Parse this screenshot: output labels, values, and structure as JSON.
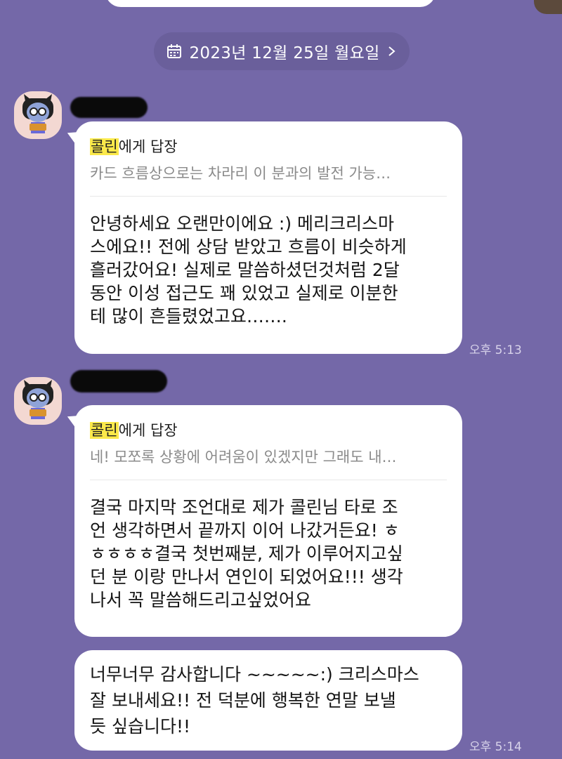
{
  "date_divider": {
    "label": "2023년 12월 25일 월요일",
    "icon": "calendar-icon",
    "chevron": "chevron-right-icon"
  },
  "messages": [
    {
      "reply": {
        "target": "콜린",
        "suffix": "에게 답장",
        "preview": "카드 흐름상으로는 차라리 이 분과의 발전 가능…"
      },
      "lines": [
        "안녕하세요 오랜만이에요 :) 메리크리스마",
        "스에요!! 전에 상담 받았고 흐름이 비슷하게",
        "흘러갔어요! 실제로 말씀하셨던것처럼 2달",
        "동안 이성 접근도 꽤 있었고 실제로 이분한",
        "테 많이 흔들렸었고요……."
      ],
      "time": "오후 5:13"
    },
    {
      "reply": {
        "target": "콜린",
        "suffix": "에게 답장",
        "preview": "네! 모쪼록 상황에 어려움이 있겠지만 그래도 내…"
      },
      "lines": [
        "결국 마지막 조언대로 제가 콜린님 타로 조",
        "언 생각하면서 끝까지 이어 나갔거든요! ㅎ",
        "ㅎㅎㅎㅎ결국 첫번째분, 제가 이루어지고싶",
        "던 분 이랑 만나서 연인이 되었어요!!! 생각",
        "나서 꼭 말씀해드리고싶었어요"
      ]
    },
    {
      "lines": [
        "너무너무 감사합니다 ~~~~~:) 크리스마스",
        "잘 보내세요!! 전 덕분에 행복한 연말 보낼",
        "듯 싶습니다!!"
      ],
      "time": "오후 5:14"
    }
  ],
  "colors": {
    "background": "#7468a8",
    "bubble": "#ffffff",
    "highlight": "#fbe94a"
  }
}
